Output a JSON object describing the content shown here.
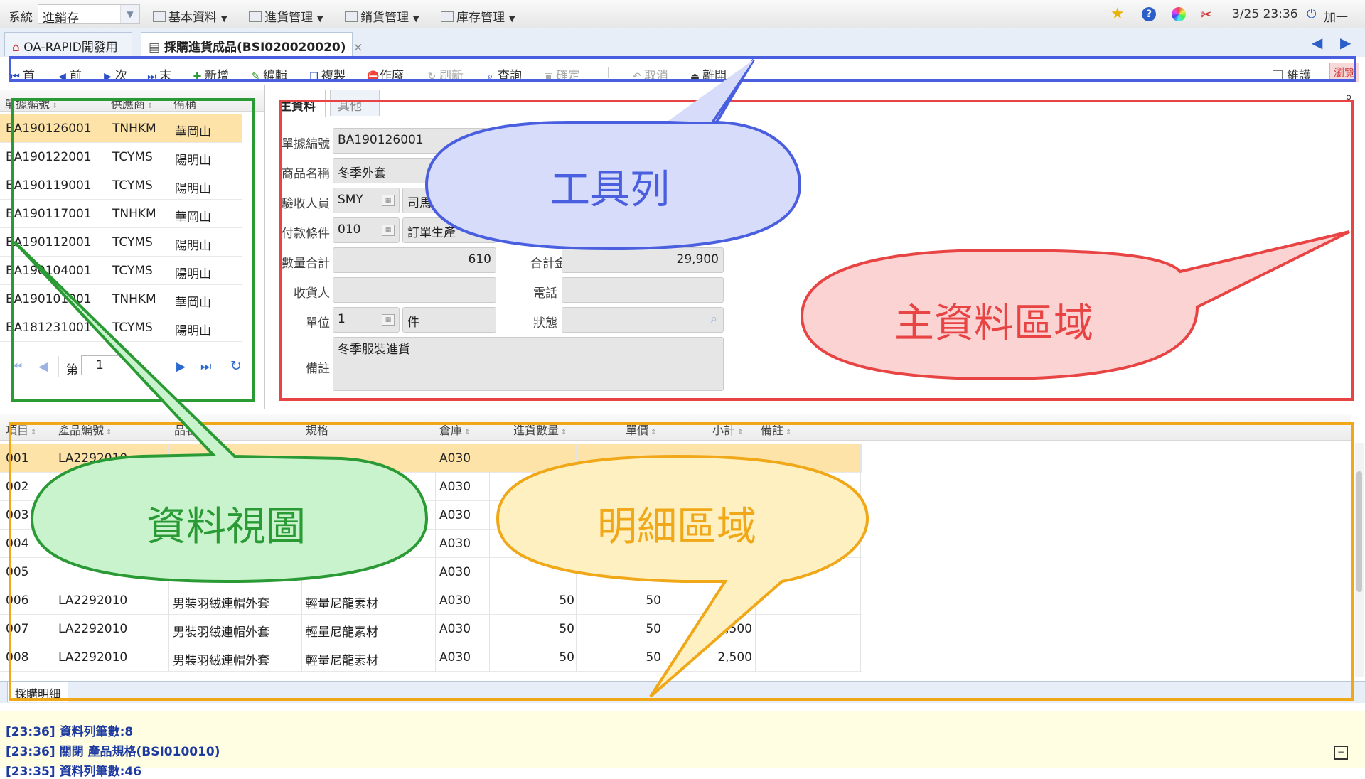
{
  "topbar": {
    "system_label": "系統",
    "system_value": "進銷存",
    "menus": [
      "基本資料",
      "進貨管理",
      "銷貨管理",
      "庫存管理"
    ],
    "datetime": "3/25 23:36",
    "user_action": "加一"
  },
  "tabs": [
    {
      "label": "OA-RAPID開發用"
    },
    {
      "label": "採購進貨成品(BSI020020020)",
      "close": "×"
    }
  ],
  "toolbar": {
    "first": "首",
    "prev": "前",
    "next": "次",
    "last": "末",
    "add": "新增",
    "edit": "編輯",
    "copy": "複製",
    "void": "作廢",
    "refresh": "刷新",
    "query": "查詢",
    "confirm": "確定",
    "cancel": "取消",
    "leave": "離開",
    "keep_checkbox": "維護",
    "browse": "瀏覽"
  },
  "list_view": {
    "columns": [
      "單據編號",
      "供應商",
      "備稱"
    ],
    "rows": [
      [
        "BA190126001",
        "TNHKM",
        "華岡山"
      ],
      [
        "BA190122001",
        "TCYMS",
        "陽明山"
      ],
      [
        "BA190119001",
        "TCYMS",
        "陽明山"
      ],
      [
        "BA190117001",
        "TNHKM",
        "華岡山"
      ],
      [
        "BA190112001",
        "TCYMS",
        "陽明山"
      ],
      [
        "BA190104001",
        "TCYMS",
        "陽明山"
      ],
      [
        "BA190101001",
        "TNHKM",
        "華岡山"
      ],
      [
        "BA181231001",
        "TCYMS",
        "陽明山"
      ]
    ],
    "pager": {
      "page_label": "第",
      "page_value": "1"
    }
  },
  "main_form": {
    "tabs": [
      "主資料",
      "其他"
    ],
    "doc_no_label": "單據編號",
    "doc_no": "BA190126001",
    "product_label": "商品名稱",
    "product": "冬季外套",
    "inspector_label": "驗收人員",
    "inspector_code": "SMY",
    "inspector_name": "司馬",
    "payment_label": "付款條件",
    "payment_code": "010",
    "payment_name": "訂單生產",
    "qty_total_label": "數量合計",
    "qty_total": "610",
    "amount_total_label": "合計金額",
    "amount_total": "29,900",
    "receiver_label": "收貨人",
    "receiver": "",
    "phone_label": "電話",
    "phone": "",
    "unit_label": "單位",
    "unit_code": "1",
    "unit_name": "件",
    "status_label": "狀態",
    "status": "",
    "note_label": "備註",
    "note": "冬季服裝進貨"
  },
  "detail": {
    "columns": [
      "項目",
      "產品編號",
      "品名",
      "規格",
      "倉庫",
      "進貨數量",
      "單價",
      "小計",
      "備註"
    ],
    "rows": [
      [
        "001",
        "LA2292010",
        "",
        "",
        "A030",
        "",
        "",
        "",
        ""
      ],
      [
        "002",
        "",
        "",
        "",
        "A030",
        "",
        "",
        "",
        ""
      ],
      [
        "003",
        "",
        "",
        "",
        "A030",
        "",
        "",
        "",
        ""
      ],
      [
        "004",
        "",
        "",
        "",
        "A030",
        "",
        "",
        "",
        ""
      ],
      [
        "005",
        "",
        "",
        "",
        "A030",
        "",
        "",
        "",
        ""
      ],
      [
        "006",
        "LA2292010",
        "男裝羽絨連帽外套",
        "輕量尼龍素材",
        "A030",
        "50",
        "50",
        "",
        ""
      ],
      [
        "007",
        "LA2292010",
        "男裝羽絨連帽外套",
        "輕量尼龍素材",
        "A030",
        "50",
        "50",
        "2,500",
        ""
      ],
      [
        "008",
        "LA2292010",
        "男裝羽絨連帽外套",
        "輕量尼龍素材",
        "A030",
        "50",
        "50",
        "2,500",
        ""
      ]
    ],
    "tab_label": "採購明細"
  },
  "callouts": {
    "toolbar": "工具列",
    "main_data": "主資料區域",
    "data_view": "資料視圖",
    "detail": "明細區域"
  },
  "log": [
    "[23:36] 資料列筆數:8",
    "[23:36] 關閉 產品規格(BSI010010)",
    "[23:35] 資料列筆數:46"
  ],
  "colors": {
    "toolbar_callout": "#4a5ee0",
    "main_callout": "#e84444",
    "view_callout": "#2a9a35",
    "detail_callout": "#f0a818"
  }
}
